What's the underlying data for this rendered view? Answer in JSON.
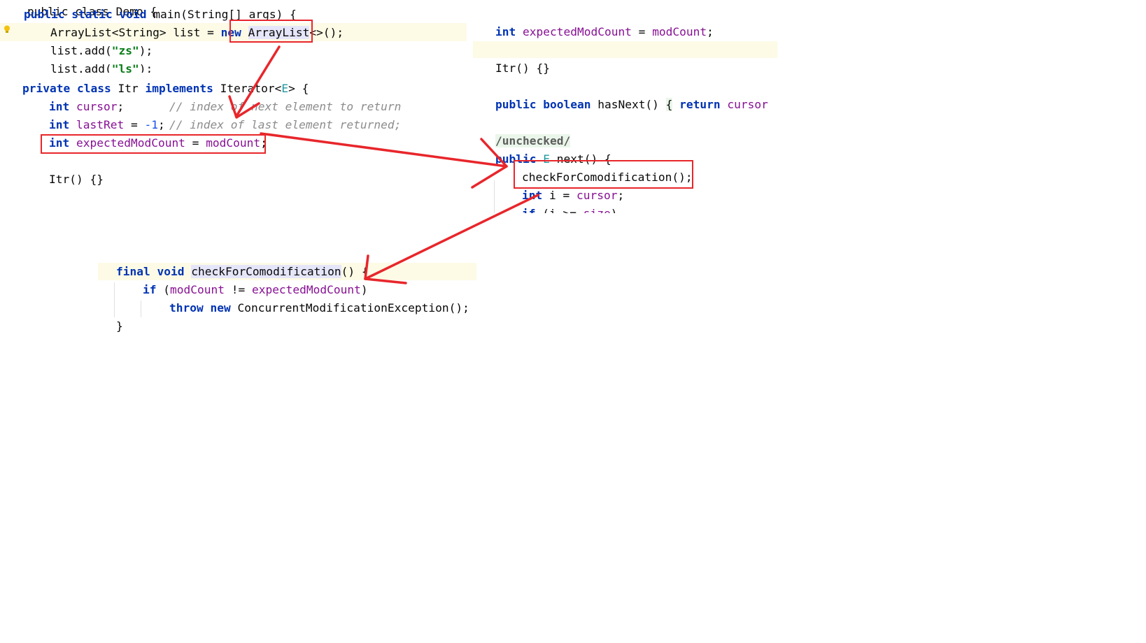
{
  "snippet1": {
    "line0": "public class Demo {",
    "line1_kw1": "public",
    "line1_kw2": "static",
    "line1_kw3": "void",
    "line1_rest": " main(String[] args) {",
    "line2_pre": "ArrayList<String> list = ",
    "line2_new": "new",
    "line2_type": "ArrayList",
    "line2_post": "<>();",
    "line3_pre": "list.add(",
    "line3_str": "\"zs\"",
    "line3_post": ");",
    "line4_pre": "list.add(",
    "line4_str": "\"ls\"",
    "line4_post": ");"
  },
  "snippet2": {
    "l1_private": "private",
    "l1_class": "class",
    "l1_name": " Itr ",
    "l1_impl": "implements",
    "l1_iter": " Iterator<",
    "l1_E": "E",
    "l1_end": "> {",
    "l2_int": "int",
    "l2_field": "cursor",
    "l2_semi": ";",
    "l2_cmt": "// index of next element to return",
    "l3_int": "int",
    "l3_field": "lastRet",
    "l3_eq": " = ",
    "l3_num": "-1",
    "l3_semi": ";",
    "l3_cmt": "// index of last element returned;",
    "l4_int": "int",
    "l4_field": "expectedModCount",
    "l4_eq": " = ",
    "l4_mod": "modCount",
    "l4_semi": ";",
    "l5": "Itr() {}"
  },
  "snippet3": {
    "l1_int": "int",
    "l1_field": "expectedModCount",
    "l1_eq": " = ",
    "l1_mod": "modCount",
    "l1_semi": ";",
    "l2": "Itr() {}",
    "l3_public": "public",
    "l3_boolean": "boolean",
    "l3_name": " hasNext() ",
    "l3_brace": "{",
    "l3_return": "return",
    "l3_cursor": "cursor",
    "l3_rest": " !",
    "l4_ann": "/unchecked/",
    "l5_public": "public",
    "l5_E": "E",
    "l5_rest": " next() {",
    "l6": "checkForComodification();",
    "l7_int": "int",
    "l7_rest": " i = ",
    "l7_cursor": "cursor",
    "l7_semi": ";",
    "l8_if": "if",
    "l8_rest": " (i >= ",
    "l8_size": "size",
    "l8_end": ")"
  },
  "snippet4": {
    "l1_final": "final",
    "l1_void": "void",
    "l1_name": "checkForComodification",
    "l1_end": "() {",
    "l2_if": "if",
    "l2_open": " (",
    "l2_mod": "modCount",
    "l2_neq": " != ",
    "l2_exp": "expectedModCount",
    "l2_close": ")",
    "l3_throw": "throw",
    "l3_new": "new",
    "l3_rest": " ConcurrentModificationException();",
    "l4": "}"
  },
  "colors": {
    "keyword": "#0033b3",
    "field": "#871094",
    "string": "#067d17",
    "comment": "#8c8c8c",
    "number": "#1750eb",
    "annotation_red": "#e8262b",
    "current_line": "#fdfbe6"
  },
  "icons": [
    "lightbulb-icon",
    "arrow-annotation"
  ]
}
